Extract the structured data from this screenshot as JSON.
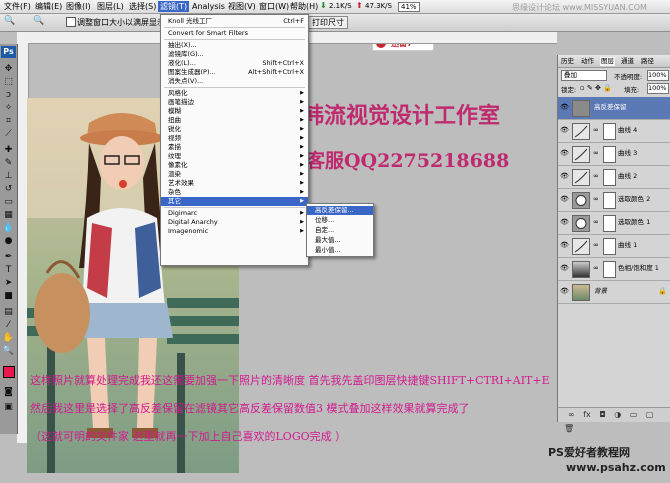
{
  "menubar": {
    "items": [
      "文件(F)",
      "编辑(E)",
      "图像(I)",
      "图层(L)",
      "选择(S)",
      "滤镜(T)",
      "Analysis",
      "视图(V)",
      "窗口(W)",
      "帮助(H)"
    ],
    "active_index": 5,
    "network_speed": [
      "2.1K/S",
      "47.3K/S"
    ],
    "zoom_readout": "41%",
    "watermark": "思缘设计论坛 www.MISSYUAN.COM"
  },
  "options_bar": {
    "checkbox_label": "调整窗口大小以满屏显示",
    "print_size_button": "打印尺寸"
  },
  "xunlei_badge": "迅雷7",
  "filter_menu": {
    "items": [
      {
        "label": "Knoll 光线工厂",
        "shortcut": "Ctrl+F",
        "submenu": false
      },
      {
        "label": "Convert for Smart Filters",
        "shortcut": "",
        "submenu": false
      },
      {
        "label": "抽出(X)...",
        "shortcut": "",
        "submenu": false
      },
      {
        "label": "滤镜库(G)...",
        "shortcut": "",
        "submenu": false
      },
      {
        "label": "液化(L)...",
        "shortcut": "Shift+Ctrl+X",
        "submenu": false
      },
      {
        "label": "图案生成器(P)...",
        "shortcut": "Alt+Shift+Ctrl+X",
        "submenu": false
      },
      {
        "label": "消失点(V)...",
        "shortcut": "",
        "submenu": false
      },
      {
        "label": "风格化",
        "shortcut": "",
        "submenu": true
      },
      {
        "label": "画笔描边",
        "shortcut": "",
        "submenu": true
      },
      {
        "label": "模糊",
        "shortcut": "",
        "submenu": true
      },
      {
        "label": "扭曲",
        "shortcut": "",
        "submenu": true
      },
      {
        "label": "锐化",
        "shortcut": "",
        "submenu": true
      },
      {
        "label": "视频",
        "shortcut": "",
        "submenu": true
      },
      {
        "label": "素描",
        "shortcut": "",
        "submenu": true
      },
      {
        "label": "纹理",
        "shortcut": "",
        "submenu": true
      },
      {
        "label": "像素化",
        "shortcut": "",
        "submenu": true
      },
      {
        "label": "渲染",
        "shortcut": "",
        "submenu": true
      },
      {
        "label": "艺术效果",
        "shortcut": "",
        "submenu": true
      },
      {
        "label": "杂色",
        "shortcut": "",
        "submenu": true
      },
      {
        "label": "其它",
        "shortcut": "",
        "submenu": true
      },
      {
        "label": "Digimarc",
        "shortcut": "",
        "submenu": true
      },
      {
        "label": "Digital Anarchy",
        "shortcut": "",
        "submenu": true
      },
      {
        "label": "Imagenomic",
        "shortcut": "",
        "submenu": true
      }
    ],
    "highlighted_index": 19
  },
  "submenu_other": {
    "items": [
      "高反差保留...",
      "位移...",
      "自定...",
      "最大值...",
      "最小值..."
    ],
    "highlighted_index": 0
  },
  "layers_panel": {
    "tabs": [
      "历史",
      "动作",
      "图层",
      "通道",
      "路径"
    ],
    "blend_mode": "叠加",
    "opacity_label": "不透明度:",
    "opacity_value": "100%",
    "lock_label": "锁定:",
    "fill_label": "填充:",
    "fill_value": "100%",
    "layers": [
      {
        "name": "高反差保留",
        "selected": true,
        "kind": "gray"
      },
      {
        "name": "曲线 4",
        "selected": false,
        "kind": "curve"
      },
      {
        "name": "曲线 3",
        "selected": false,
        "kind": "curve"
      },
      {
        "name": "曲线 2",
        "selected": false,
        "kind": "curve"
      },
      {
        "name": "选取颜色 2",
        "selected": false,
        "kind": "selective"
      },
      {
        "name": "选取颜色 1",
        "selected": false,
        "kind": "selective"
      },
      {
        "name": "曲线 1",
        "selected": false,
        "kind": "curve"
      },
      {
        "name": "色相/饱和度 1",
        "selected": false,
        "kind": "hue"
      },
      {
        "name": "背景",
        "selected": false,
        "kind": "photo"
      }
    ]
  },
  "canvas_text": {
    "studio_title": "韩流视觉设计工作室",
    "service_qq": "客服QQ2275218688",
    "line1": "这样照片就算处理完成我还这需要加强一下照片的清晰度    首先我先盖印图层快捷键SHIFT+CTRI+AIT+E",
    "line2": "然后我这里是选择了高反差保留在滤镜其它高反差保留数值3 模式叠加这样效果就算完成了",
    "line3": "（这就可明的文件家  这里就再一下加上自己喜欢的LOGO完成  ）"
  },
  "footer_watermark": {
    "line1": "PS爱好者教程网",
    "line2": "www.psahz.com"
  },
  "colors": {
    "foreground_swatch": "#e8174f",
    "background_swatch": "#ffffff",
    "menu_highlight": "#3a66c8"
  }
}
